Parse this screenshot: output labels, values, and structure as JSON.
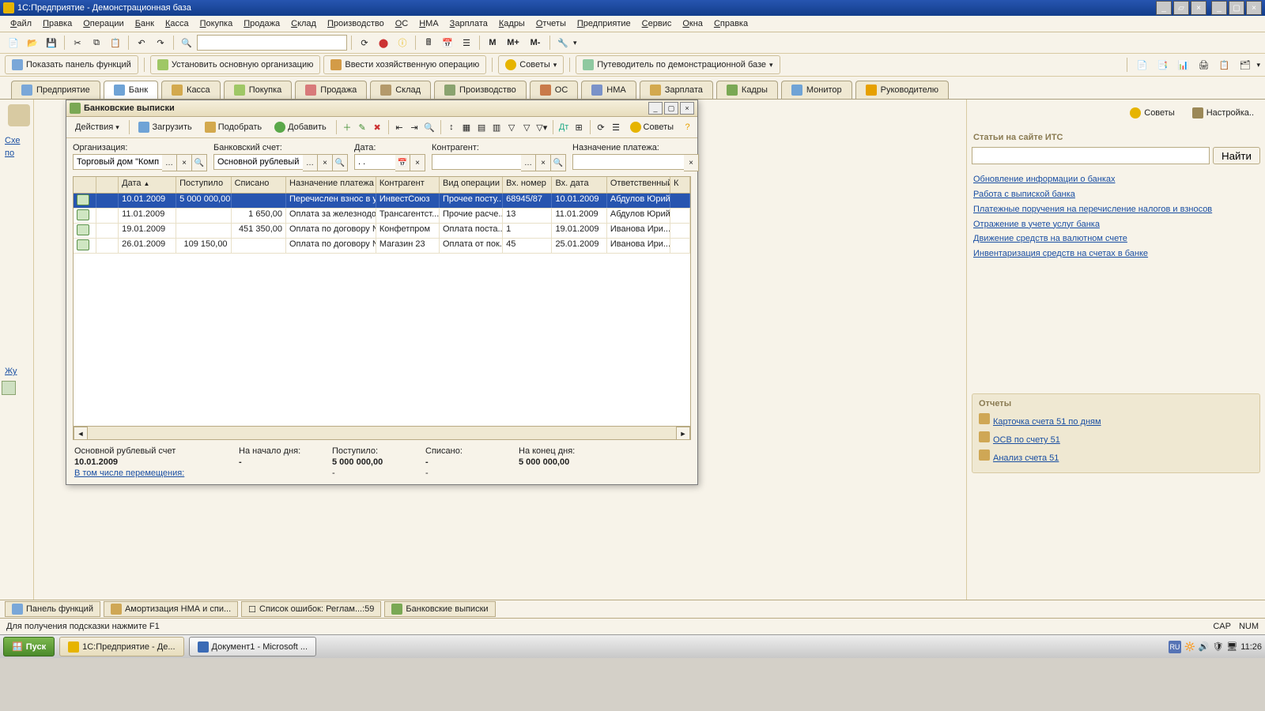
{
  "app": {
    "title": "1С:Предприятие - Демонстрационная база"
  },
  "menus": [
    "Файл",
    "Правка",
    "Операции",
    "Банк",
    "Касса",
    "Покупка",
    "Продажа",
    "Склад",
    "Производство",
    "ОС",
    "НМА",
    "Зарплата",
    "Кадры",
    "Отчеты",
    "Предприятие",
    "Сервис",
    "Окна",
    "Справка"
  ],
  "tb1": {
    "m": "M",
    "mplus": "M+",
    "mminus": "M-"
  },
  "tb2": {
    "panel": "Показать панель функций",
    "org": "Установить основную организацию",
    "op": "Ввести хозяйственную операцию",
    "tips": "Советы",
    "guide": "Путеводитель по демонстрационной базе"
  },
  "tabs": [
    "Предприятие",
    "Банк",
    "Касса",
    "Покупка",
    "Продажа",
    "Склад",
    "Производство",
    "ОС",
    "НМА",
    "Зарплата",
    "Кадры",
    "Монитор",
    "Руководителю"
  ],
  "side": {
    "sxe": "Схе",
    "po": "по",
    "jur": "Жу"
  },
  "right": {
    "tips": "Советы",
    "settings": "Настройка..",
    "its_title": "Статьи на сайте ИТС",
    "find": "Найти",
    "links": [
      "Обновление информации о банках",
      "Работа с выпиской банка",
      "Платежные поручения на перечисление налогов и взносов",
      "Отражение в учете услуг банка",
      "Движение средств на валютном счете",
      "Инвентаризация средств на счетах в банке"
    ],
    "reports_title": "Отчеты",
    "reports": [
      "Карточка счета 51 по дням",
      "ОСВ по счету 51",
      "Анализ счета 51"
    ]
  },
  "win": {
    "title": "Банковские выписки",
    "tb": {
      "actions": "Действия",
      "load": "Загрузить",
      "pick": "Подобрать",
      "add": "Добавить",
      "tips": "Советы"
    },
    "filters": {
      "org_l": "Организация:",
      "org_v": "Торговый дом \"Комплек",
      "acc_l": "Банковский счет:",
      "acc_v": "Основной рублевый счет",
      "date_l": "Дата:",
      "date_v": ". .",
      "contr_l": "Контрагент:",
      "contr_v": "",
      "purp_l": "Назначение платежа:",
      "purp_v": ""
    },
    "cols": [
      "",
      "",
      "Дата",
      "Поступило",
      "Списано",
      "Назначение платежа",
      "Контрагент",
      "Вид операции",
      "Вх. номер",
      "Вх. дата",
      "Ответственный",
      "К"
    ],
    "rows": [
      {
        "sel": true,
        "date": "10.01.2009",
        "in": "5 000 000,00",
        "out": "",
        "purp": "Перечислен взнос в ус...",
        "contr": "ИнвестСоюз",
        "kind": "Прочее посту...",
        "vnum": "68945/87",
        "vdate": "10.01.2009",
        "resp": "Абдулов Юрий..."
      },
      {
        "sel": false,
        "date": "11.01.2009",
        "in": "",
        "out": "1 650,00",
        "purp": "Оплата за железнодор...",
        "contr": "Трансагентст...",
        "kind": "Прочие расче...",
        "vnum": "13",
        "vdate": "11.01.2009",
        "resp": "Абдулов Юрий..."
      },
      {
        "sel": false,
        "date": "19.01.2009",
        "in": "",
        "out": "451 350,00",
        "purp": "Оплата по договору №...",
        "contr": "Конфетпром",
        "kind": "Оплата поста...",
        "vnum": "1",
        "vdate": "19.01.2009",
        "resp": "Иванова Ири..."
      },
      {
        "sel": false,
        "date": "26.01.2009",
        "in": "109 150,00",
        "out": "",
        "purp": "Оплата по договору №...",
        "contr": "Магазин 23",
        "kind": "Оплата от пок...",
        "vnum": "45",
        "vdate": "25.01.2009",
        "resp": "Иванова Ири..."
      }
    ],
    "summary": {
      "acc": "Основной рублевый счет",
      "date": "10.01.2009",
      "begin_l": "На начало дня:",
      "begin_v": "-",
      "in_l": "Поступило:",
      "in_v": "5 000 000,00",
      "out_l": "Списано:",
      "out_v": "-",
      "end_l": "На конец дня:",
      "end_v": "5 000 000,00",
      "move": "В том числе перемещения:",
      "m1": "-",
      "m2": "-"
    }
  },
  "docbar": {
    "panel": "Панель функций",
    "amort": "Амортизация НМА и спи...",
    "errors": "Список ошибок: Реглам...:59",
    "bank": "Банковские выписки"
  },
  "status": {
    "hint": "Для получения подсказки нажмите F1",
    "cap": "CAP",
    "num": "NUM"
  },
  "taskbar": {
    "start": "Пуск",
    "a": "1С:Предприятие - Де...",
    "b": "Документ1 - Microsoft ...",
    "ru": "RU",
    "time": "11:26"
  }
}
